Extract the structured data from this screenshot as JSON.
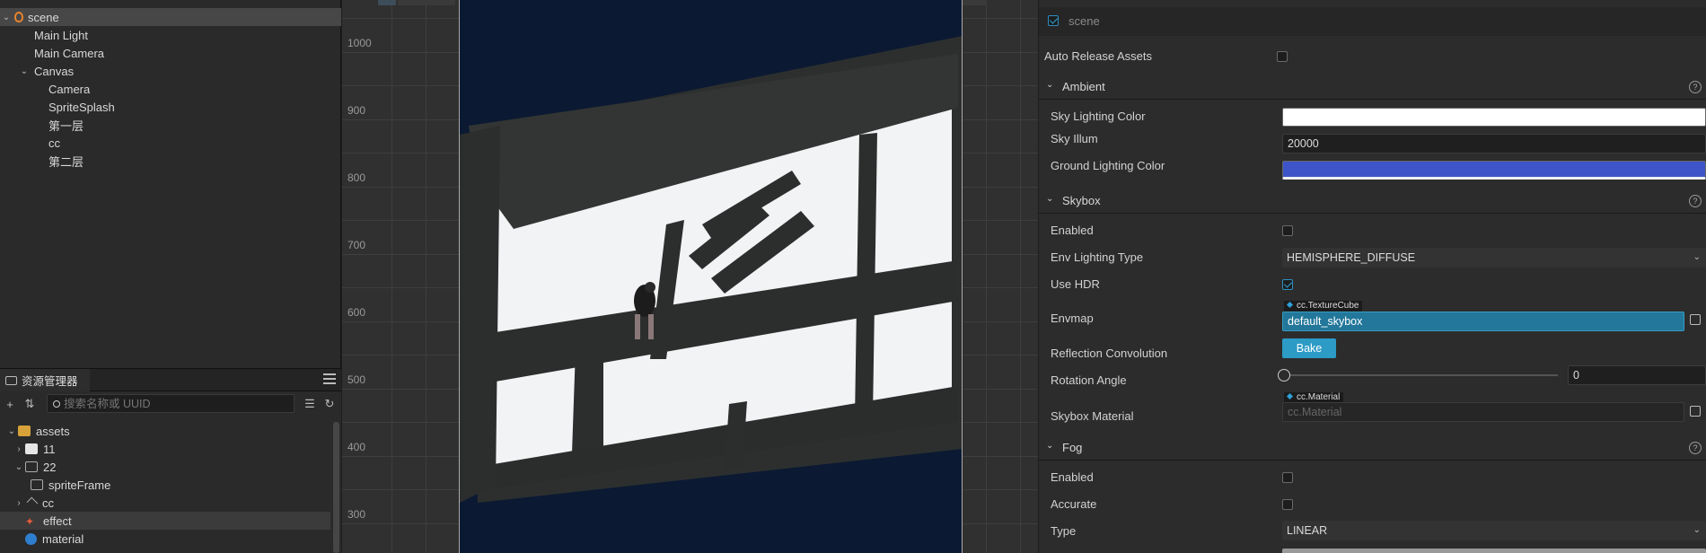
{
  "hierarchy": {
    "root": "scene",
    "items": [
      {
        "label": "Main Light"
      },
      {
        "label": "Main Camera"
      },
      {
        "label": "Canvas"
      },
      {
        "label": "Camera"
      },
      {
        "label": "SpriteSplash"
      },
      {
        "label": "第一层"
      },
      {
        "label": "cc"
      },
      {
        "label": "第二层"
      }
    ]
  },
  "assets_panel": {
    "title": "资源管理器",
    "search_placeholder": "搜索名称或 UUID",
    "items": [
      {
        "label": "assets"
      },
      {
        "label": "11"
      },
      {
        "label": "22"
      },
      {
        "label": "spriteFrame"
      },
      {
        "label": "cc"
      },
      {
        "label": "effect"
      },
      {
        "label": "material"
      }
    ]
  },
  "viewport": {
    "y_labels": [
      "1000",
      "900",
      "800",
      "700",
      "600",
      "500",
      "400",
      "300"
    ]
  },
  "inspector": {
    "node_name": "scene",
    "auto_release_label": "Auto Release Assets",
    "ambient": {
      "title": "Ambient",
      "sky_lighting_color_label": "Sky Lighting Color",
      "sky_lighting_color": "#ffffff",
      "sky_illum_label": "Sky Illum",
      "sky_illum": "20000",
      "ground_lighting_color_label": "Ground Lighting Color",
      "ground_lighting_color": "#3d55c8"
    },
    "skybox": {
      "title": "Skybox",
      "enabled_label": "Enabled",
      "env_lighting_type_label": "Env Lighting Type",
      "env_lighting_type": "HEMISPHERE_DIFFUSE",
      "use_hdr_label": "Use HDR",
      "envmap_label": "Envmap",
      "envmap_type": "cc.TextureCube",
      "envmap_value": "default_skybox",
      "reflection_label": "Reflection Convolution",
      "bake_label": "Bake",
      "rotation_label": "Rotation Angle",
      "rotation_value": "0",
      "skybox_material_label": "Skybox Material",
      "skybox_material_type": "cc.Material",
      "skybox_material_placeholder": "cc.Material"
    },
    "fog": {
      "title": "Fog",
      "enabled_label": "Enabled",
      "accurate_label": "Accurate",
      "type_label": "Type",
      "type_value": "LINEAR"
    },
    "help_glyph": "?"
  }
}
